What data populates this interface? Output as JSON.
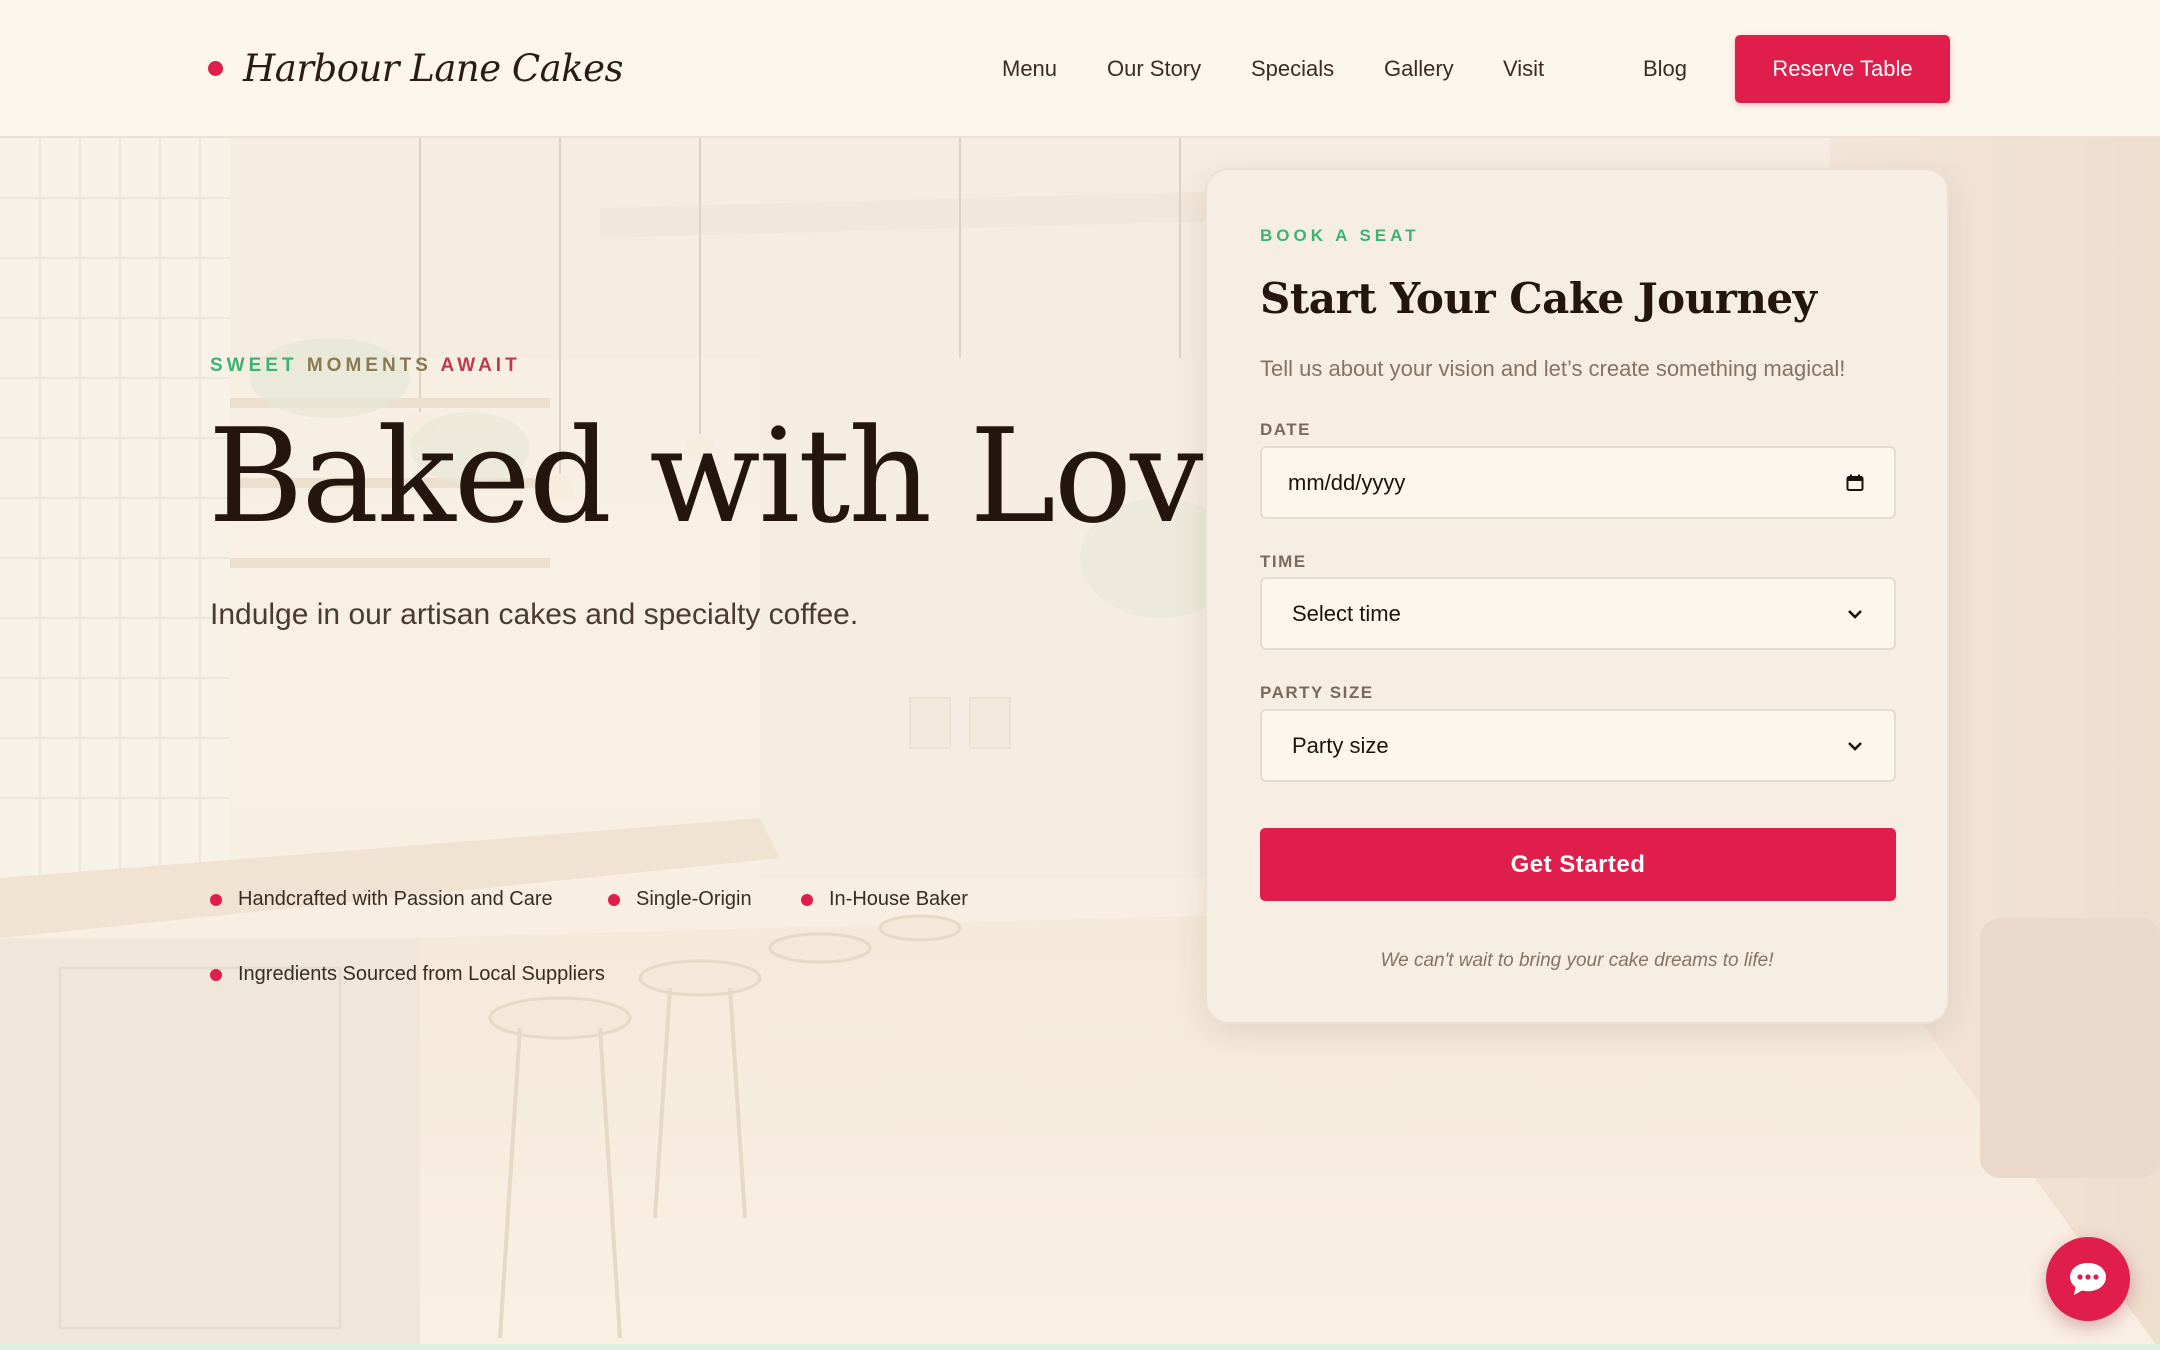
{
  "brand": {
    "name": "Harbour Lane Cakes",
    "accent": "#e01e4c"
  },
  "nav": {
    "links": [
      "Menu",
      "Our Story",
      "Specials",
      "Gallery",
      "Visit",
      "Blog"
    ],
    "cta_label": "Reserve Table"
  },
  "hero": {
    "eyebrow_parts": [
      "SWEET ",
      "MOMENTS ",
      "AWAIT"
    ],
    "headline": "Baked with Love",
    "subhead": "Indulge in our artisan cakes and specialty coffee.",
    "features": [
      "Handcrafted with Passion and Care",
      "Single-Origin",
      "In-House Baker",
      "Ingredients Sourced from Local Suppliers"
    ]
  },
  "booking": {
    "eyebrow": "BOOK A SEAT",
    "title": "Start Your Cake Journey",
    "description": "Tell us about your vision and let’s create something magical!",
    "date_label": "DATE",
    "date_value": "mm/dd/yyyy",
    "time_label": "TIME",
    "time_value": "Select time",
    "party_label": "PARTY SIZE",
    "party_value": "Party size",
    "submit_label": "Get Started",
    "note": "We can't wait to bring your cake dreams to life!"
  },
  "colors": {
    "accent": "#e01e4c",
    "eyebrow_green": "#3cb371",
    "background": "#fdf6ec"
  },
  "icons": {
    "calendar": "calendar-icon",
    "dropdown": "chevron-down-icon",
    "chat": "chat-bubble-icon"
  }
}
